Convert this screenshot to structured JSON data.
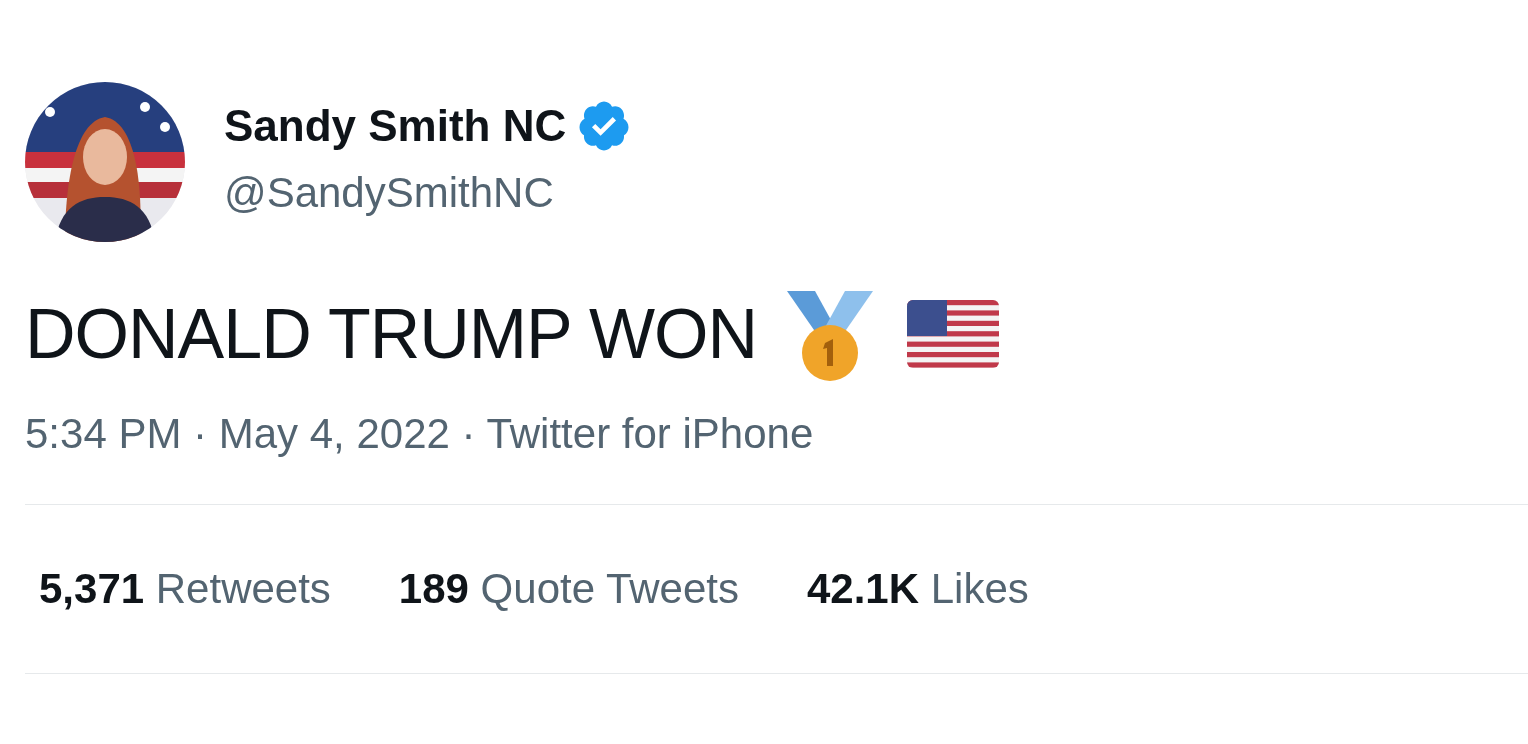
{
  "author": {
    "name": "Sandy Smith NC",
    "verified": true,
    "handle": "@SandySmithNC"
  },
  "tweet": {
    "text": "DONALD TRUMP WON",
    "emoji": [
      {
        "kind": "medal"
      },
      {
        "kind": "flag"
      }
    ]
  },
  "meta": "5:34 PM · May 4, 2022 · Twitter for iPhone",
  "stats": [
    {
      "count": "5,371",
      "label": "Retweets"
    },
    {
      "count": "189",
      "label": "Quote Tweets"
    },
    {
      "count": "42.1K",
      "label": "Likes"
    }
  ]
}
